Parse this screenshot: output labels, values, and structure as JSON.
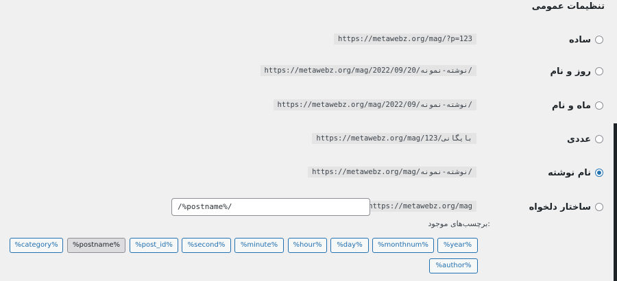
{
  "header": {
    "title": "تنظیمات عمومی"
  },
  "options": [
    {
      "label": "ساده",
      "url": "https://metawebz.org/mag/?p=123",
      "checked": false
    },
    {
      "label": "روز و نام",
      "url": "https://metawebz.org/mag/2022/09/20/نوشته-نمونه/",
      "checked": false
    },
    {
      "label": "ماه و نام",
      "url": "https://metawebz.org/mag/2022/09/نوشته-نمونه/",
      "checked": false
    },
    {
      "label": "عددی",
      "url": "https://metawebz.org/mag/بایگانی/123",
      "checked": false
    },
    {
      "label": "نام نوشته",
      "url": "https://metawebz.org/mag/نوشته-نمونه/",
      "checked": true
    }
  ],
  "custom": {
    "label": "ساختار دلخواه",
    "base_url": "https://metawebz.org/mag",
    "value": "/%postname%/",
    "checked": false
  },
  "tags": {
    "label": "برچسب‌های موجود:",
    "items": [
      "%category%",
      "%postname%",
      "%post_id%",
      "%second%",
      "%minute%",
      "%hour%",
      "%day%",
      "%monthnum%",
      "%year%",
      "%author%"
    ],
    "active": "%postname%"
  }
}
